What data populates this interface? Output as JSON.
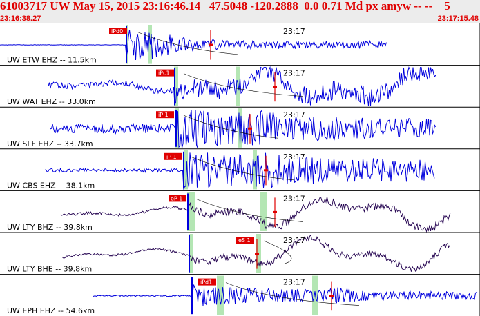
{
  "header": {
    "title": "61003717 UW May 15, 2015 23:16:46.14   47.5048 -120.2888  0.0 0.71 Md px amyw -- --    5",
    "start_time": "23:16:38.27",
    "end_time": "23:17:15.48"
  },
  "colors": {
    "header_bg": "#ececec",
    "header_text": "#e00000",
    "trace_ehz": "#0000dd",
    "trace_bh": "#2a0a55",
    "pick_marker": "#e00000",
    "window_band": "#b4e6b4",
    "separator": "#000000"
  },
  "minute_label": "23:17",
  "traces": [
    {
      "label": "UW ETW EHZ -- 11.5km",
      "pick": "iPd0",
      "style": "ehz"
    },
    {
      "label": "UW WAT EHZ -- 33.0km",
      "pick": "iPc1",
      "style": "ehz"
    },
    {
      "label": "UW SLF EHZ -- 33.7km",
      "pick": "iP 1",
      "style": "ehz"
    },
    {
      "label": "UW CBS EHZ -- 38.1km",
      "pick": "iP 1",
      "style": "ehz"
    },
    {
      "label": "UW LTY BHZ -- 39.8km",
      "pick": "eP 1",
      "style": "bh"
    },
    {
      "label": "UW LTY BHE -- 39.8km",
      "pick": "eS 1",
      "style": "bh"
    },
    {
      "label": "UW EPH EHZ -- 54.6km",
      "pick": "iPd1",
      "style": "ehz"
    }
  ]
}
